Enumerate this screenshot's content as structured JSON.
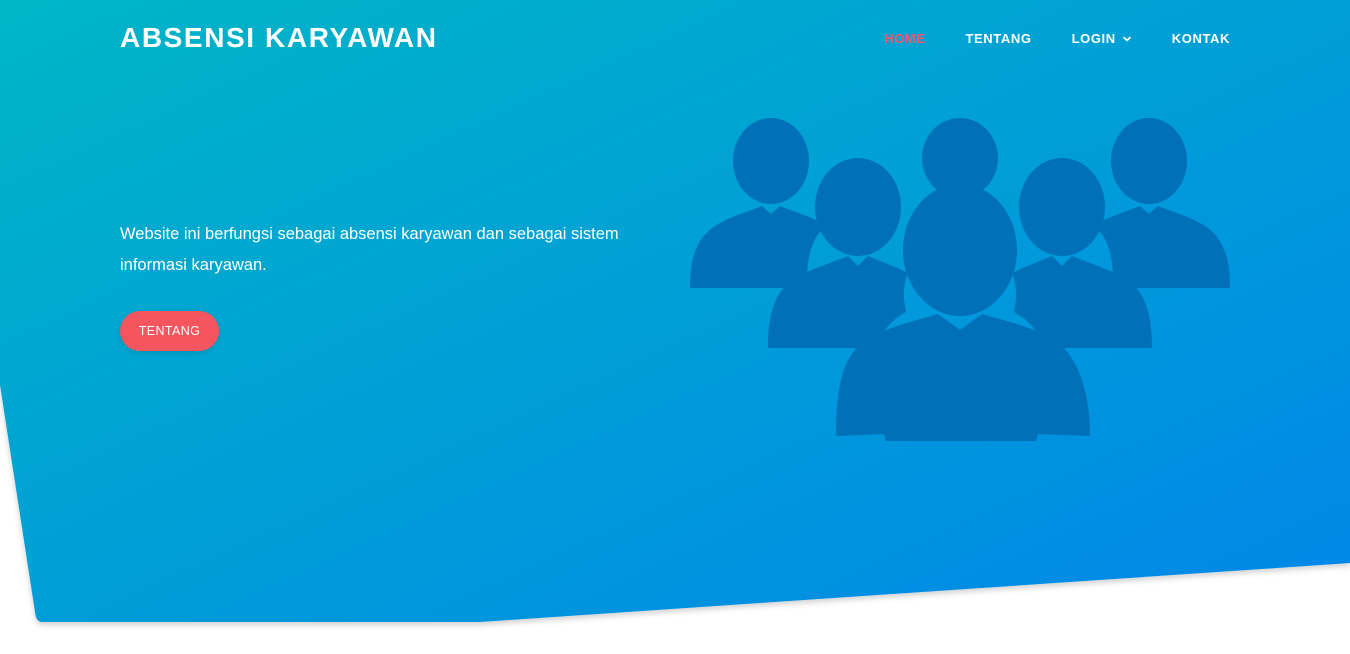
{
  "header": {
    "brand": "ABSENSI KARYAWAN",
    "nav": [
      {
        "label": "HOME",
        "active": true
      },
      {
        "label": "TENTANG",
        "active": false
      },
      {
        "label": "LOGIN",
        "active": false,
        "dropdown": true
      },
      {
        "label": "KONTAK",
        "active": false
      }
    ]
  },
  "hero": {
    "description": "Website ini berfungsi sebagai absensi karyawan dan sebagai sistem informasi karyawan.",
    "button_label": "TENTANG",
    "illustration_icon": "users-group-icon"
  },
  "colors": {
    "gradient_start": "#00b3c8",
    "gradient_end": "#0088e6",
    "accent": "#f5555f",
    "active_nav": "#f6566b",
    "illustration": "#0070b8"
  }
}
